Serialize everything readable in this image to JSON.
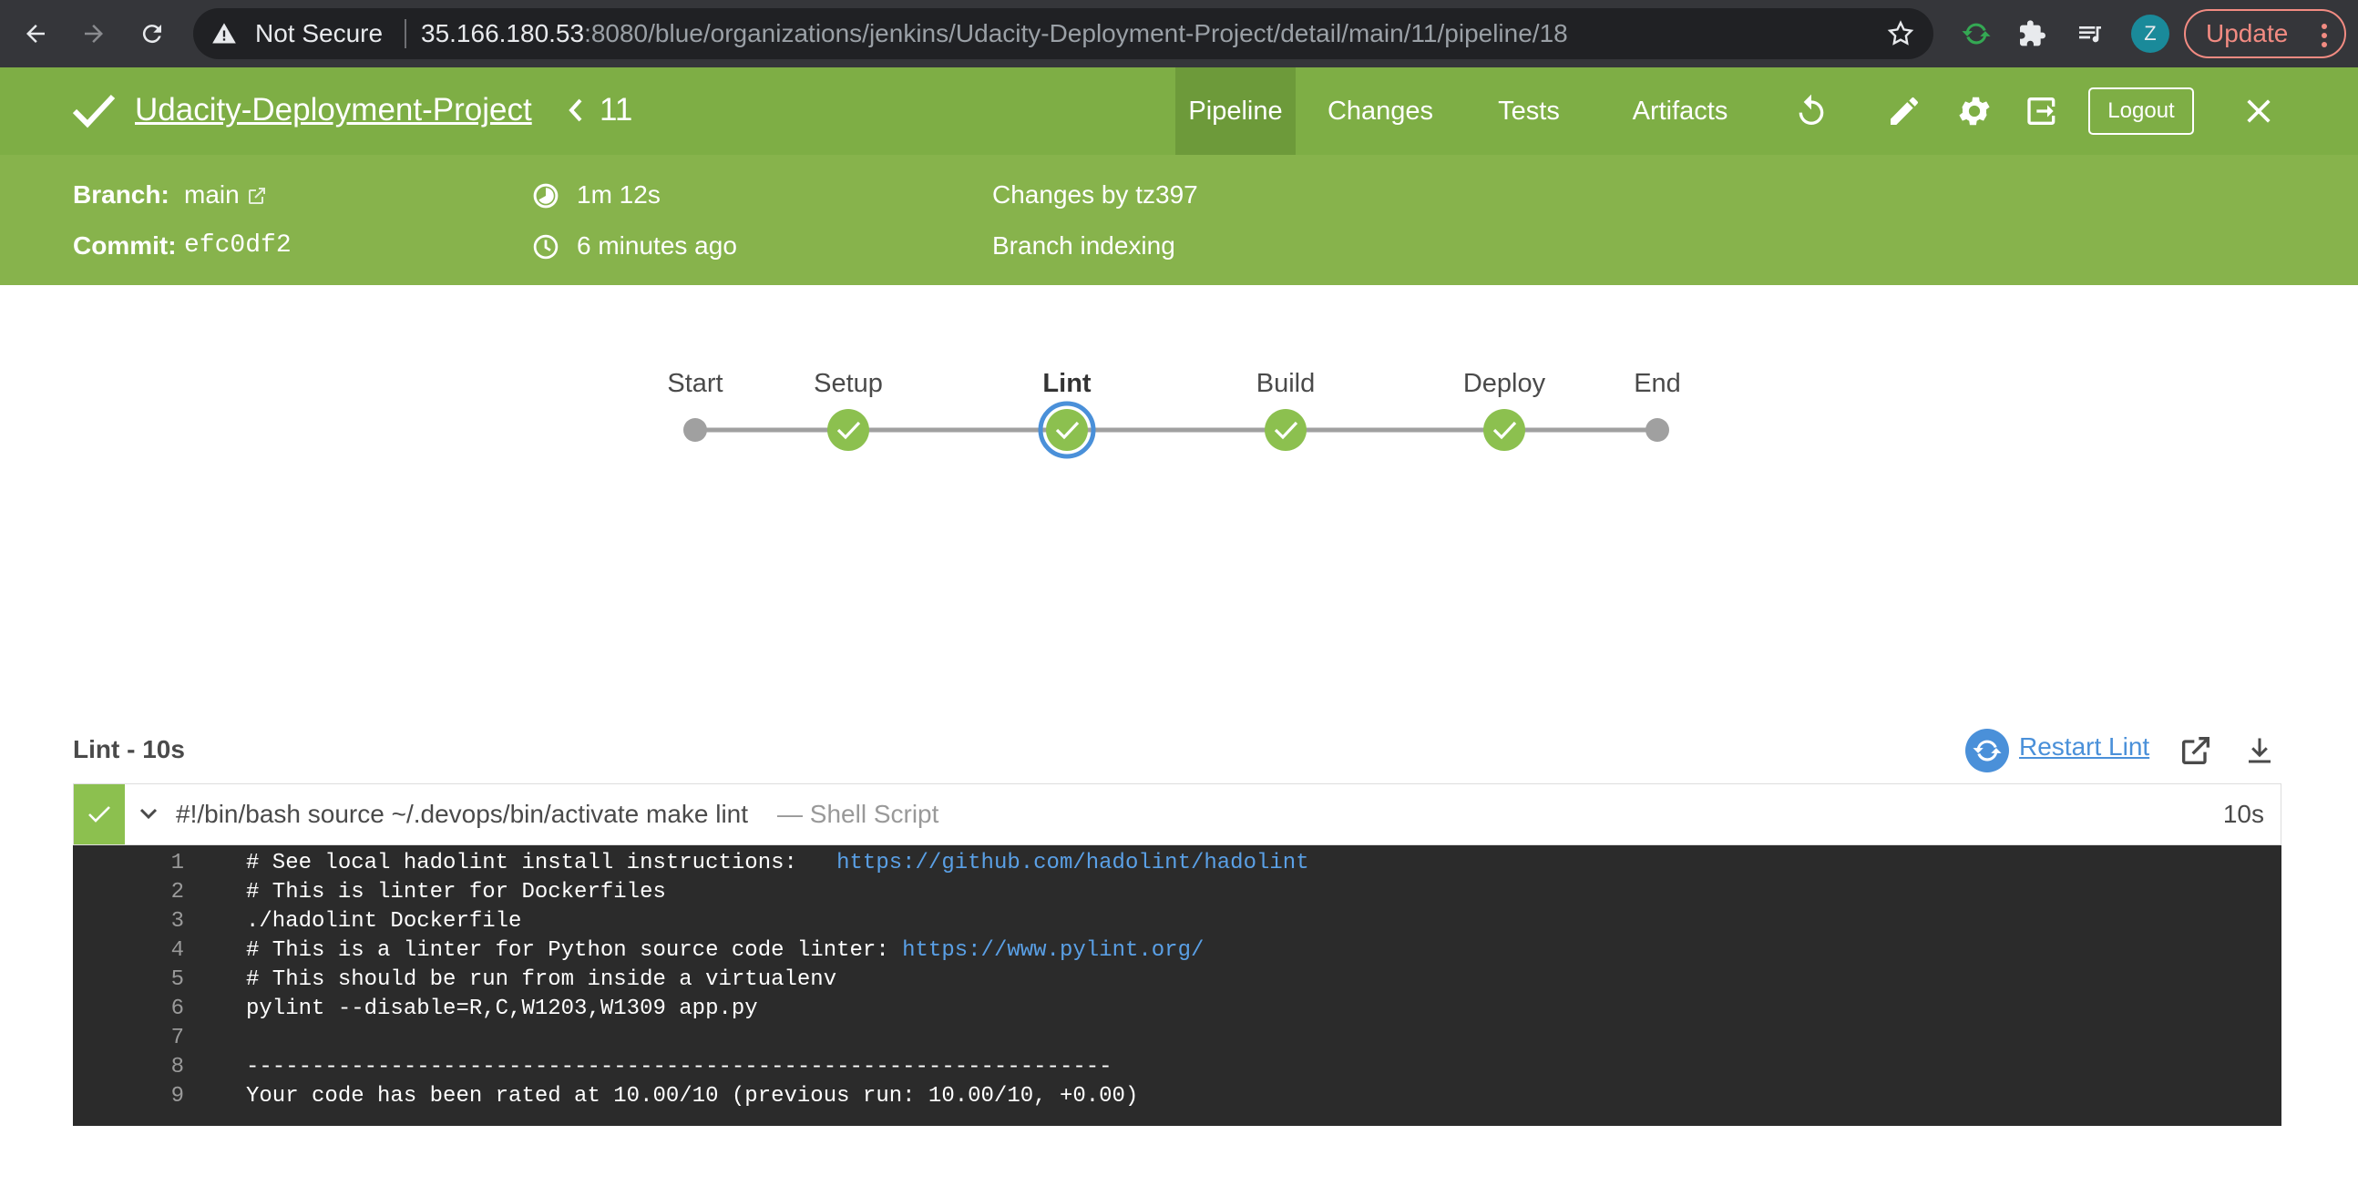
{
  "browser": {
    "security_label": "Not Secure",
    "url_host": "35.166.180.53",
    "url_rest": ":8080/blue/organizations/jenkins/Udacity-Deployment-Project/detail/main/11/pipeline/18",
    "profile_initial": "Z",
    "update_label": "Update"
  },
  "header": {
    "project": "Udacity-Deployment-Project",
    "run_number": "11",
    "tabs": [
      "Pipeline",
      "Changes",
      "Tests",
      "Artifacts"
    ],
    "active_tab": "Pipeline",
    "logout_label": "Logout"
  },
  "summary": {
    "branch_label": "Branch:",
    "branch_value": "main",
    "commit_label": "Commit:",
    "commit_value": "efc0df2",
    "duration": "1m 12s",
    "started": "6 minutes ago",
    "changes": "Changes by tz397",
    "cause": "Branch indexing"
  },
  "pipeline": {
    "stages": [
      {
        "label": "Start",
        "status": "start"
      },
      {
        "label": "Setup",
        "status": "success"
      },
      {
        "label": "Lint",
        "status": "success",
        "selected": true
      },
      {
        "label": "Build",
        "status": "success"
      },
      {
        "label": "Deploy",
        "status": "success"
      },
      {
        "label": "End",
        "status": "end"
      }
    ],
    "colors": {
      "success": "#8cc04f",
      "connector": "#a0a0a0",
      "selected_ring": "#4a90d9"
    }
  },
  "step_section": {
    "title": "Lint - 10s",
    "restart_label": "Restart Lint"
  },
  "step": {
    "command": "#!/bin/bash source ~/.devops/bin/activate make lint",
    "type": "— Shell Script",
    "duration": "10s"
  },
  "log": [
    {
      "n": "1",
      "text": "# See local hadolint install instructions:   ",
      "link": "https://github.com/hadolint/hadolint"
    },
    {
      "n": "2",
      "text": "# This is linter for Dockerfiles"
    },
    {
      "n": "3",
      "text": "./hadolint Dockerfile"
    },
    {
      "n": "4",
      "text": "# This is a linter for Python source code linter: ",
      "link": "https://www.pylint.org/"
    },
    {
      "n": "5",
      "text": "# This should be run from inside a virtualenv"
    },
    {
      "n": "6",
      "text": "pylint --disable=R,C,W1203,W1309 app.py"
    },
    {
      "n": "7",
      "text": ""
    },
    {
      "n": "8",
      "text": "------------------------------------------------------------------"
    },
    {
      "n": "9",
      "text": "Your code has been rated at 10.00/10 (previous run: 10.00/10, +0.00)"
    }
  ]
}
